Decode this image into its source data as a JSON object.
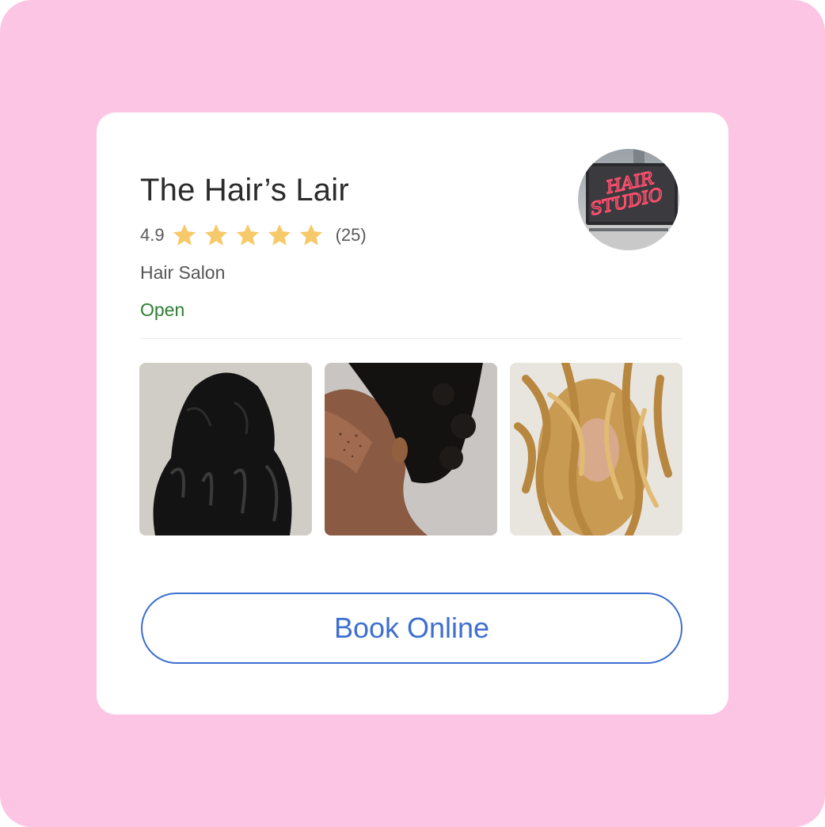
{
  "business": {
    "name": "The Hair’s Lair",
    "rating": "4.9",
    "stars": 5,
    "review_count": "(25)",
    "category": "Hair Salon",
    "status": "Open"
  },
  "logo": {
    "sign_text_line1": "HAIR",
    "sign_text_line2": "STUDIO"
  },
  "actions": {
    "book_label": "Book Online"
  },
  "colors": {
    "background": "#fcc5e4",
    "card": "#ffffff",
    "star": "#f6c96a",
    "status_open": "#2e7d32",
    "button_accent": "#3e6fd0"
  },
  "icons": {
    "star": "star-icon"
  }
}
